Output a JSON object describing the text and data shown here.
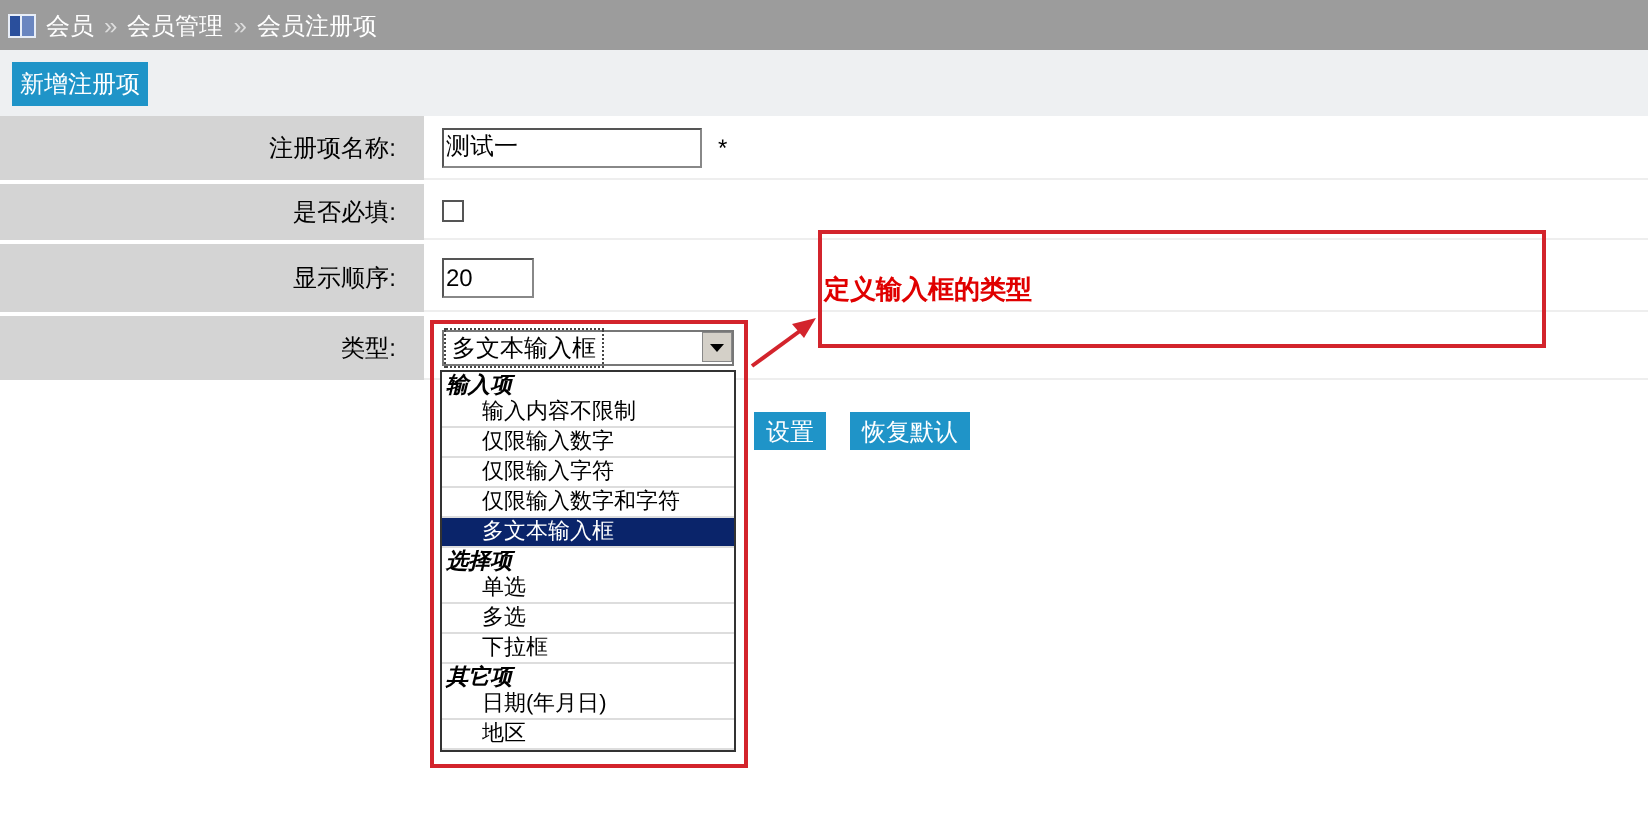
{
  "breadcrumb": {
    "items": [
      "会员",
      "会员管理",
      "会员注册项"
    ],
    "separator": "»"
  },
  "toolbar": {
    "button": "新增注册项"
  },
  "form": [
    {
      "kind": "text",
      "label": "注册项名称:",
      "value": "测试一",
      "required_mark": "*"
    },
    {
      "kind": "checkbox",
      "label": "是否必填:",
      "checked": false
    },
    {
      "kind": "number",
      "label": "显示顺序:",
      "value": "20"
    },
    {
      "kind": "select",
      "label": "类型:",
      "value": "多文本输入框"
    }
  ],
  "buttons": [
    "设置",
    "恢复默认"
  ],
  "dropdown": [
    {
      "group": "输入项",
      "options": [
        {
          "label": "输入内容不限制",
          "selected": false
        },
        {
          "label": "仅限输入数字",
          "selected": false
        },
        {
          "label": "仅限输入字符",
          "selected": false
        },
        {
          "label": "仅限输入数字和字符",
          "selected": false
        },
        {
          "label": "多文本输入框",
          "selected": true
        }
      ]
    },
    {
      "group": "选择项",
      "options": [
        {
          "label": "单选",
          "selected": false
        },
        {
          "label": "多选",
          "selected": false
        },
        {
          "label": "下拉框",
          "selected": false
        }
      ]
    },
    {
      "group": "其它项",
      "options": [
        {
          "label": "日期(年月日)",
          "selected": false
        },
        {
          "label": "地区",
          "selected": false
        }
      ]
    }
  ],
  "annotation": {
    "text": "定义输入框的类型"
  }
}
